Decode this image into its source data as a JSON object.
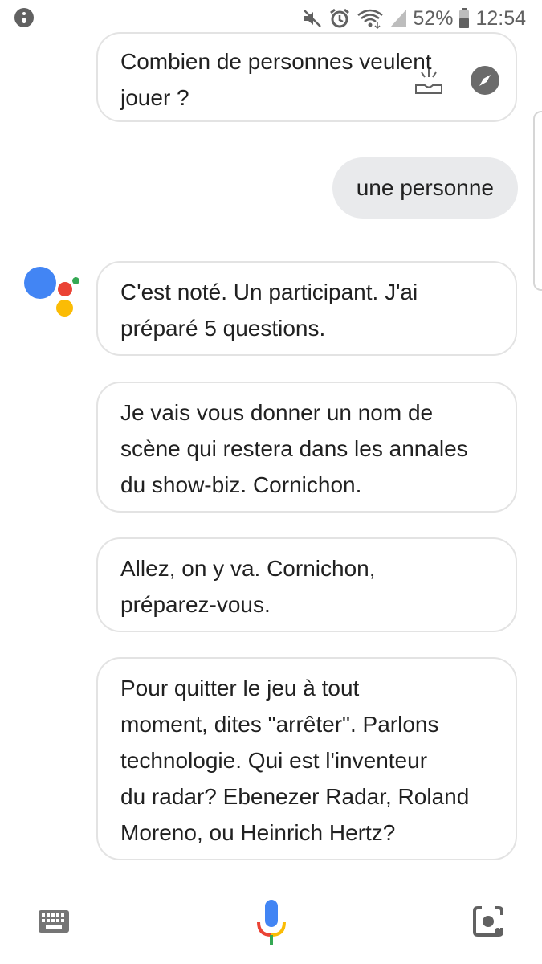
{
  "status_bar": {
    "battery": "52%",
    "time": "12:54",
    "icons": [
      "notification-dot-icon",
      "mute-icon",
      "alarm-icon",
      "wifi-icon",
      "signal-icon",
      "battery-icon"
    ]
  },
  "conversation": {
    "assistant_prompt": {
      "lines": [
        "Combien de personnes veulent",
        "jouer ?"
      ]
    },
    "user_reply": "une personne",
    "assistant_messages": [
      {
        "lines": [
          "C'est noté. Un participant. J'ai",
          "préparé 5 questions."
        ]
      },
      {
        "lines": [
          "Je vais vous donner un nom de",
          "scène qui restera dans les annales",
          "du show-biz. Cornichon."
        ]
      },
      {
        "lines": [
          "Allez, on y va. Cornichon,",
          "préparez-vous."
        ]
      },
      {
        "lines": [
          "Pour quitter le jeu à tout",
          "moment, dites \"arrêter\". Parlons",
          "technologie. Qui est l'inventeur",
          "du radar? Ebenezer Radar, Roland",
          "Moreno, ou Heinrich Hertz?"
        ]
      }
    ]
  },
  "bottom_bar": {
    "icons": [
      "keyboard-icon",
      "mic-icon",
      "lens-icon"
    ]
  },
  "colors": {
    "google_blue": "#4285f4",
    "google_red": "#ea4335",
    "google_yellow": "#fbbc05",
    "google_green": "#34a853",
    "user_bubble_bg": "#e9eaec",
    "bubble_border": "#e3e3e3"
  }
}
